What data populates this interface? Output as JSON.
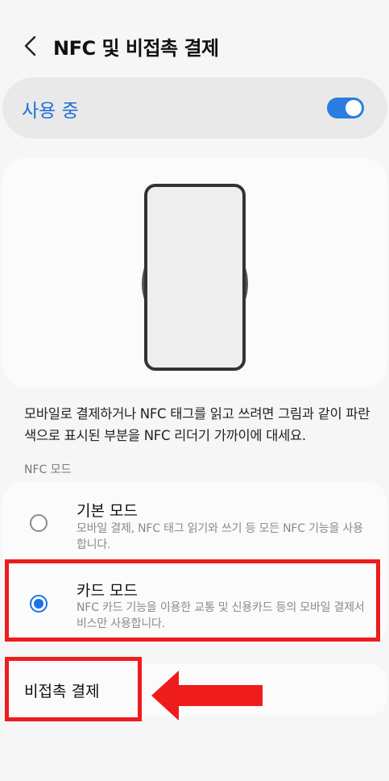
{
  "header": {
    "title": "NFC 및 비접촉 결제",
    "back_icon": "chevron-left-icon"
  },
  "master_toggle": {
    "label": "사용 중",
    "on": true,
    "accent": "#1f6fd6"
  },
  "illustration": {
    "icon": "phone-nfc-illustration"
  },
  "description": "모바일로 결제하거나 NFC 태그를 읽고 쓰려면 그림과 같이 파란색으로 표시된 부분을 NFC 리더기 가까이에 대세요.",
  "nfc_mode": {
    "section_label": "NFC 모드",
    "options": [
      {
        "title": "기본 모드",
        "desc": "모바일 결제, NFC 태그 읽기와 쓰기 등 모든 NFC 기능을 사용합니다.",
        "selected": false
      },
      {
        "title": "카드 모드",
        "desc": "NFC 카드 기능을 이용한 교통 및 신용카드 등의 모바일 결제서비스만 사용합니다.",
        "selected": true
      }
    ]
  },
  "contactless_payment": {
    "label": "비접촉 결제"
  },
  "annotation": {
    "color": "#ee1c1c"
  }
}
